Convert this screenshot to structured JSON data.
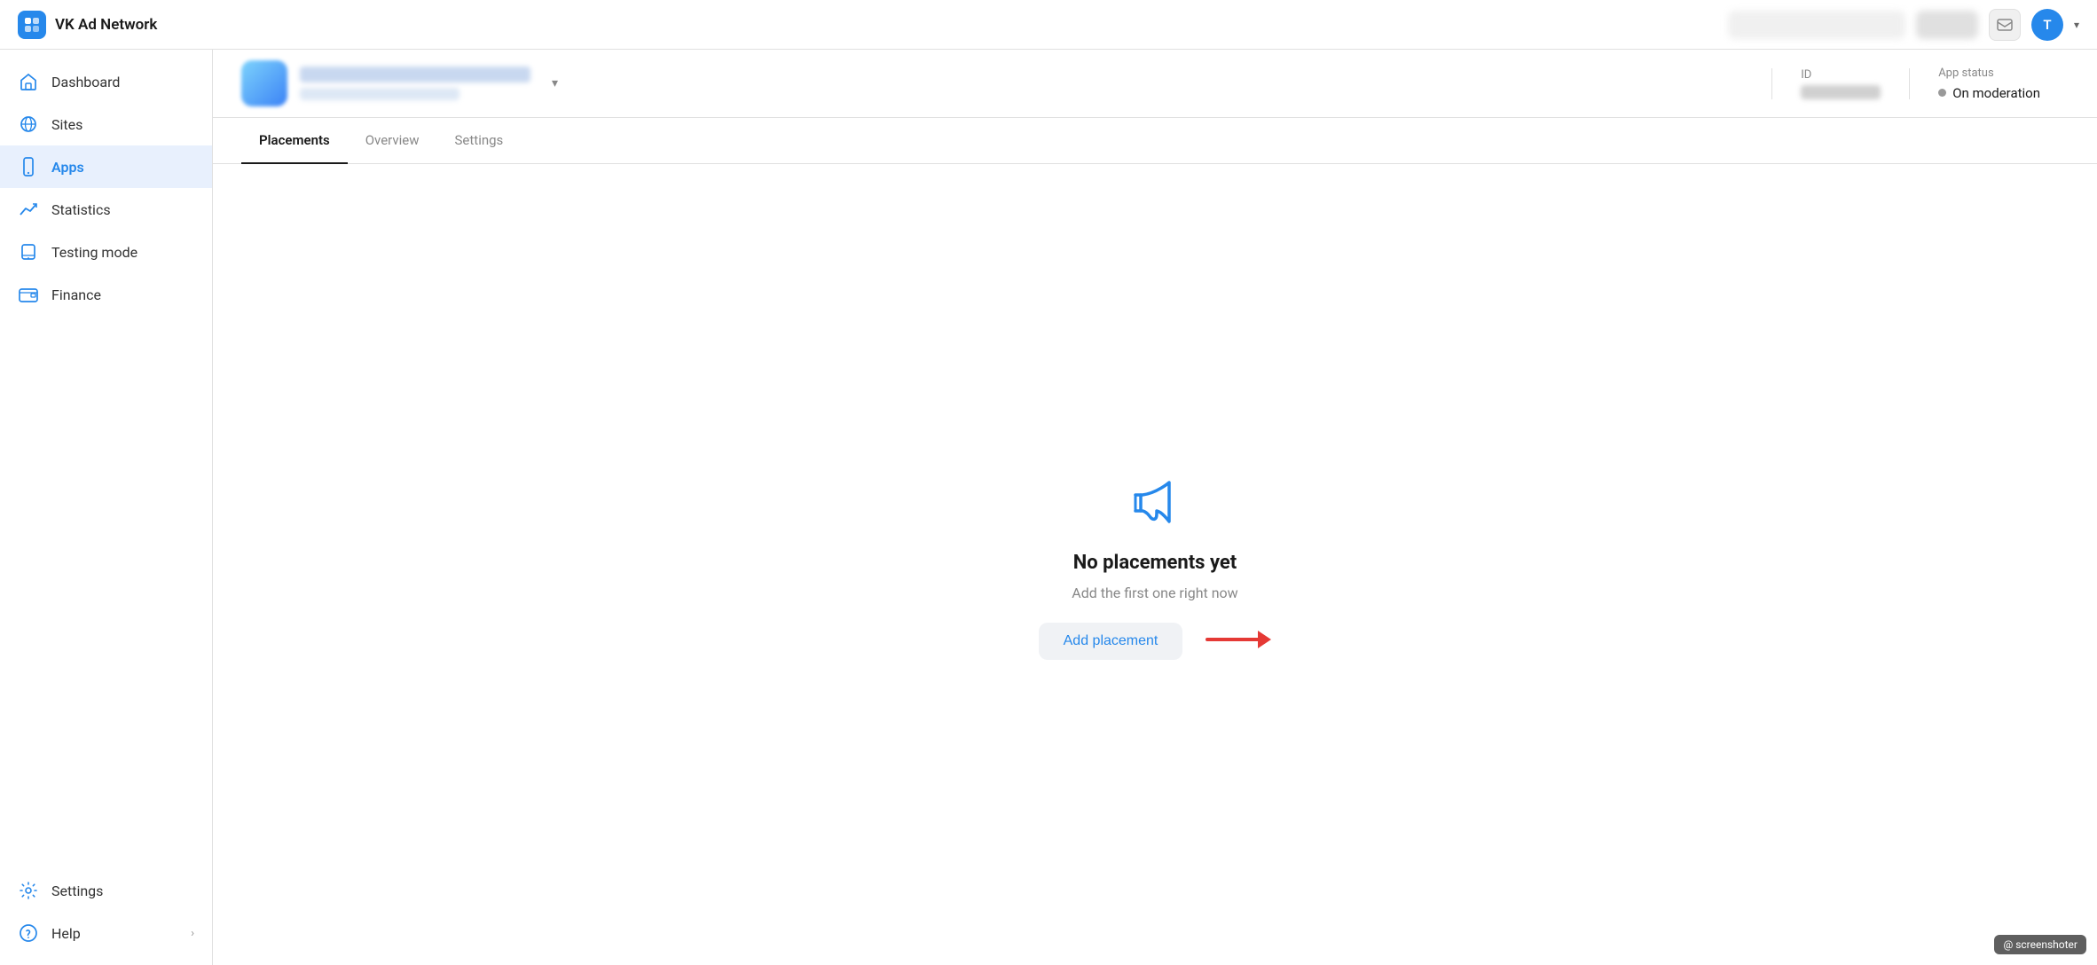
{
  "header": {
    "logo_text": "VK Ad Network",
    "avatar_letter": "T"
  },
  "sidebar": {
    "items": [
      {
        "id": "dashboard",
        "label": "Dashboard",
        "icon": "home"
      },
      {
        "id": "sites",
        "label": "Sites",
        "icon": "globe"
      },
      {
        "id": "apps",
        "label": "Apps",
        "icon": "phone",
        "active": true
      },
      {
        "id": "statistics",
        "label": "Statistics",
        "icon": "chart"
      },
      {
        "id": "testing",
        "label": "Testing mode",
        "icon": "device"
      },
      {
        "id": "finance",
        "label": "Finance",
        "icon": "wallet"
      }
    ],
    "bottom_items": [
      {
        "id": "settings",
        "label": "Settings",
        "icon": "gear"
      },
      {
        "id": "help",
        "label": "Help",
        "icon": "help",
        "has_chevron": true
      }
    ]
  },
  "app_bar": {
    "id_label": "ID",
    "status_label": "App status",
    "status_value": "On moderation",
    "dropdown_arrow": "▾"
  },
  "tabs": [
    {
      "id": "placements",
      "label": "Placements",
      "active": true
    },
    {
      "id": "overview",
      "label": "Overview",
      "active": false
    },
    {
      "id": "settings",
      "label": "Settings",
      "active": false
    }
  ],
  "empty_state": {
    "title": "No placements yet",
    "subtitle": "Add the first one right now",
    "button_label": "Add placement"
  },
  "screenshoter": "@ screenshoter"
}
